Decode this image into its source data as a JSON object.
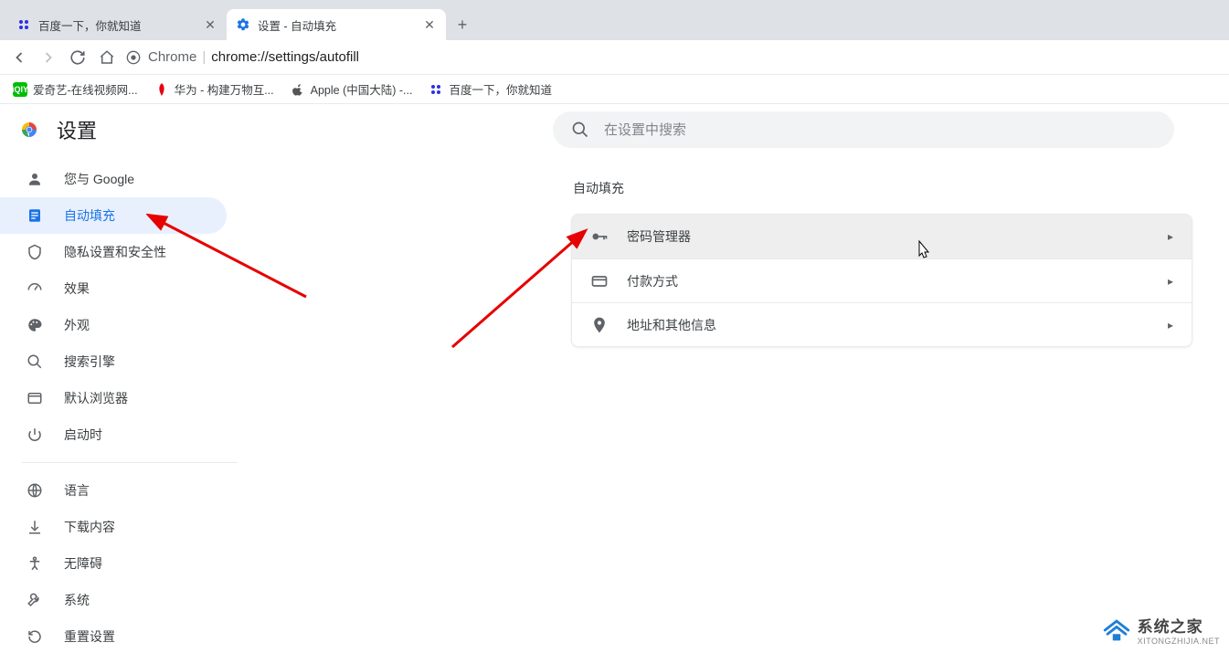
{
  "tabs": [
    {
      "title": "百度一下，你就知道",
      "active": false
    },
    {
      "title": "设置 - 自动填充",
      "active": true
    }
  ],
  "omnibox": {
    "prefix": "Chrome",
    "url": "chrome://settings/autofill"
  },
  "bookmarks": [
    {
      "label": "爱奇艺-在线视频网..."
    },
    {
      "label": "华为 - 构建万物互..."
    },
    {
      "label": "Apple (中国大陆) -..."
    },
    {
      "label": "百度一下，你就知道"
    }
  ],
  "header": {
    "title": "设置",
    "search_placeholder": "在设置中搜索"
  },
  "sidebar": {
    "items": [
      {
        "label": "您与 Google"
      },
      {
        "label": "自动填充"
      },
      {
        "label": "隐私设置和安全性"
      },
      {
        "label": "效果"
      },
      {
        "label": "外观"
      },
      {
        "label": "搜索引擎"
      },
      {
        "label": "默认浏览器"
      },
      {
        "label": "启动时"
      }
    ],
    "items2": [
      {
        "label": "语言"
      },
      {
        "label": "下载内容"
      },
      {
        "label": "无障碍"
      },
      {
        "label": "系统"
      },
      {
        "label": "重置设置"
      }
    ]
  },
  "content": {
    "section_title": "自动填充",
    "rows": [
      {
        "label": "密码管理器"
      },
      {
        "label": "付款方式"
      },
      {
        "label": "地址和其他信息"
      }
    ]
  },
  "watermark": {
    "title": "系统之家",
    "sub": "XITONGZHIJIA.NET"
  }
}
